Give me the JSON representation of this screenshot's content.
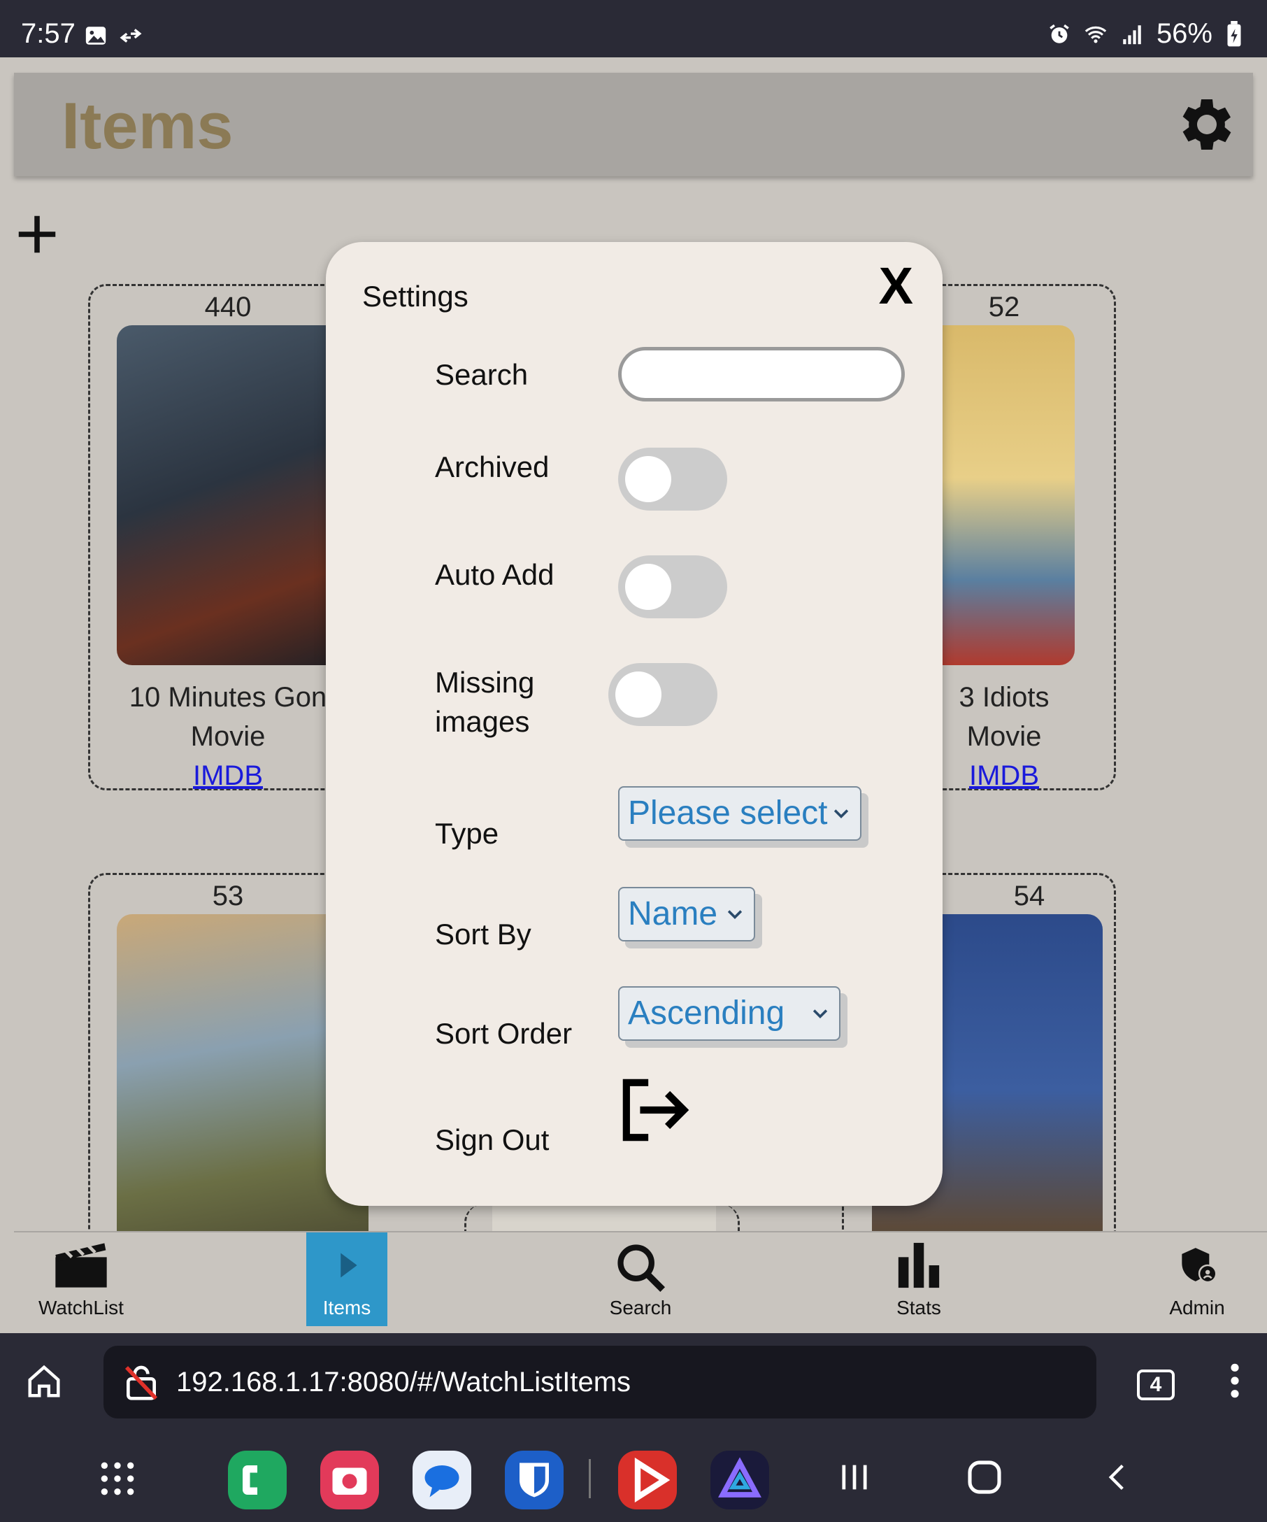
{
  "status_bar": {
    "time": "7:57",
    "battery": "56%"
  },
  "header": {
    "title": "Items"
  },
  "cards": [
    {
      "number": "440",
      "title": "10 Minutes Gon",
      "type": "Movie",
      "link": "IMDB"
    },
    {
      "number": "52",
      "title": "3 Idiots",
      "type": "Movie",
      "link": "IMDB"
    },
    {
      "number": "53"
    },
    {
      "number": "54"
    }
  ],
  "settings_modal": {
    "title": "Settings",
    "close_label": "X",
    "search_label": "Search",
    "search_value": "",
    "archived_label": "Archived",
    "archived_on": false,
    "auto_add_label": "Auto Add",
    "auto_add_on": false,
    "missing_images_label_line1": "Missing",
    "missing_images_label_line2": "images",
    "missing_images_on": false,
    "type_label": "Type",
    "type_value": "Please select",
    "sort_by_label": "Sort By",
    "sort_by_value": "Name",
    "sort_order_label": "Sort Order",
    "sort_order_value": "Ascending",
    "sign_out_label": "Sign Out"
  },
  "bottom_nav": [
    {
      "label": "WatchList",
      "icon": "clapperboard-icon"
    },
    {
      "label": "Items",
      "icon": "video-file-icon",
      "active": true
    },
    {
      "label": "Search",
      "icon": "search-icon"
    },
    {
      "label": "Stats",
      "icon": "bar-chart-icon"
    },
    {
      "label": "Admin",
      "icon": "admin-shield-icon"
    }
  ],
  "browser": {
    "url": "192.168.1.17:8080/#/WatchListItems",
    "tab_count": "4"
  },
  "colors": {
    "accent": "#2e97c9",
    "select_text": "#2a7fc0",
    "link": "#1a1adb",
    "title": "#8b7a55"
  }
}
